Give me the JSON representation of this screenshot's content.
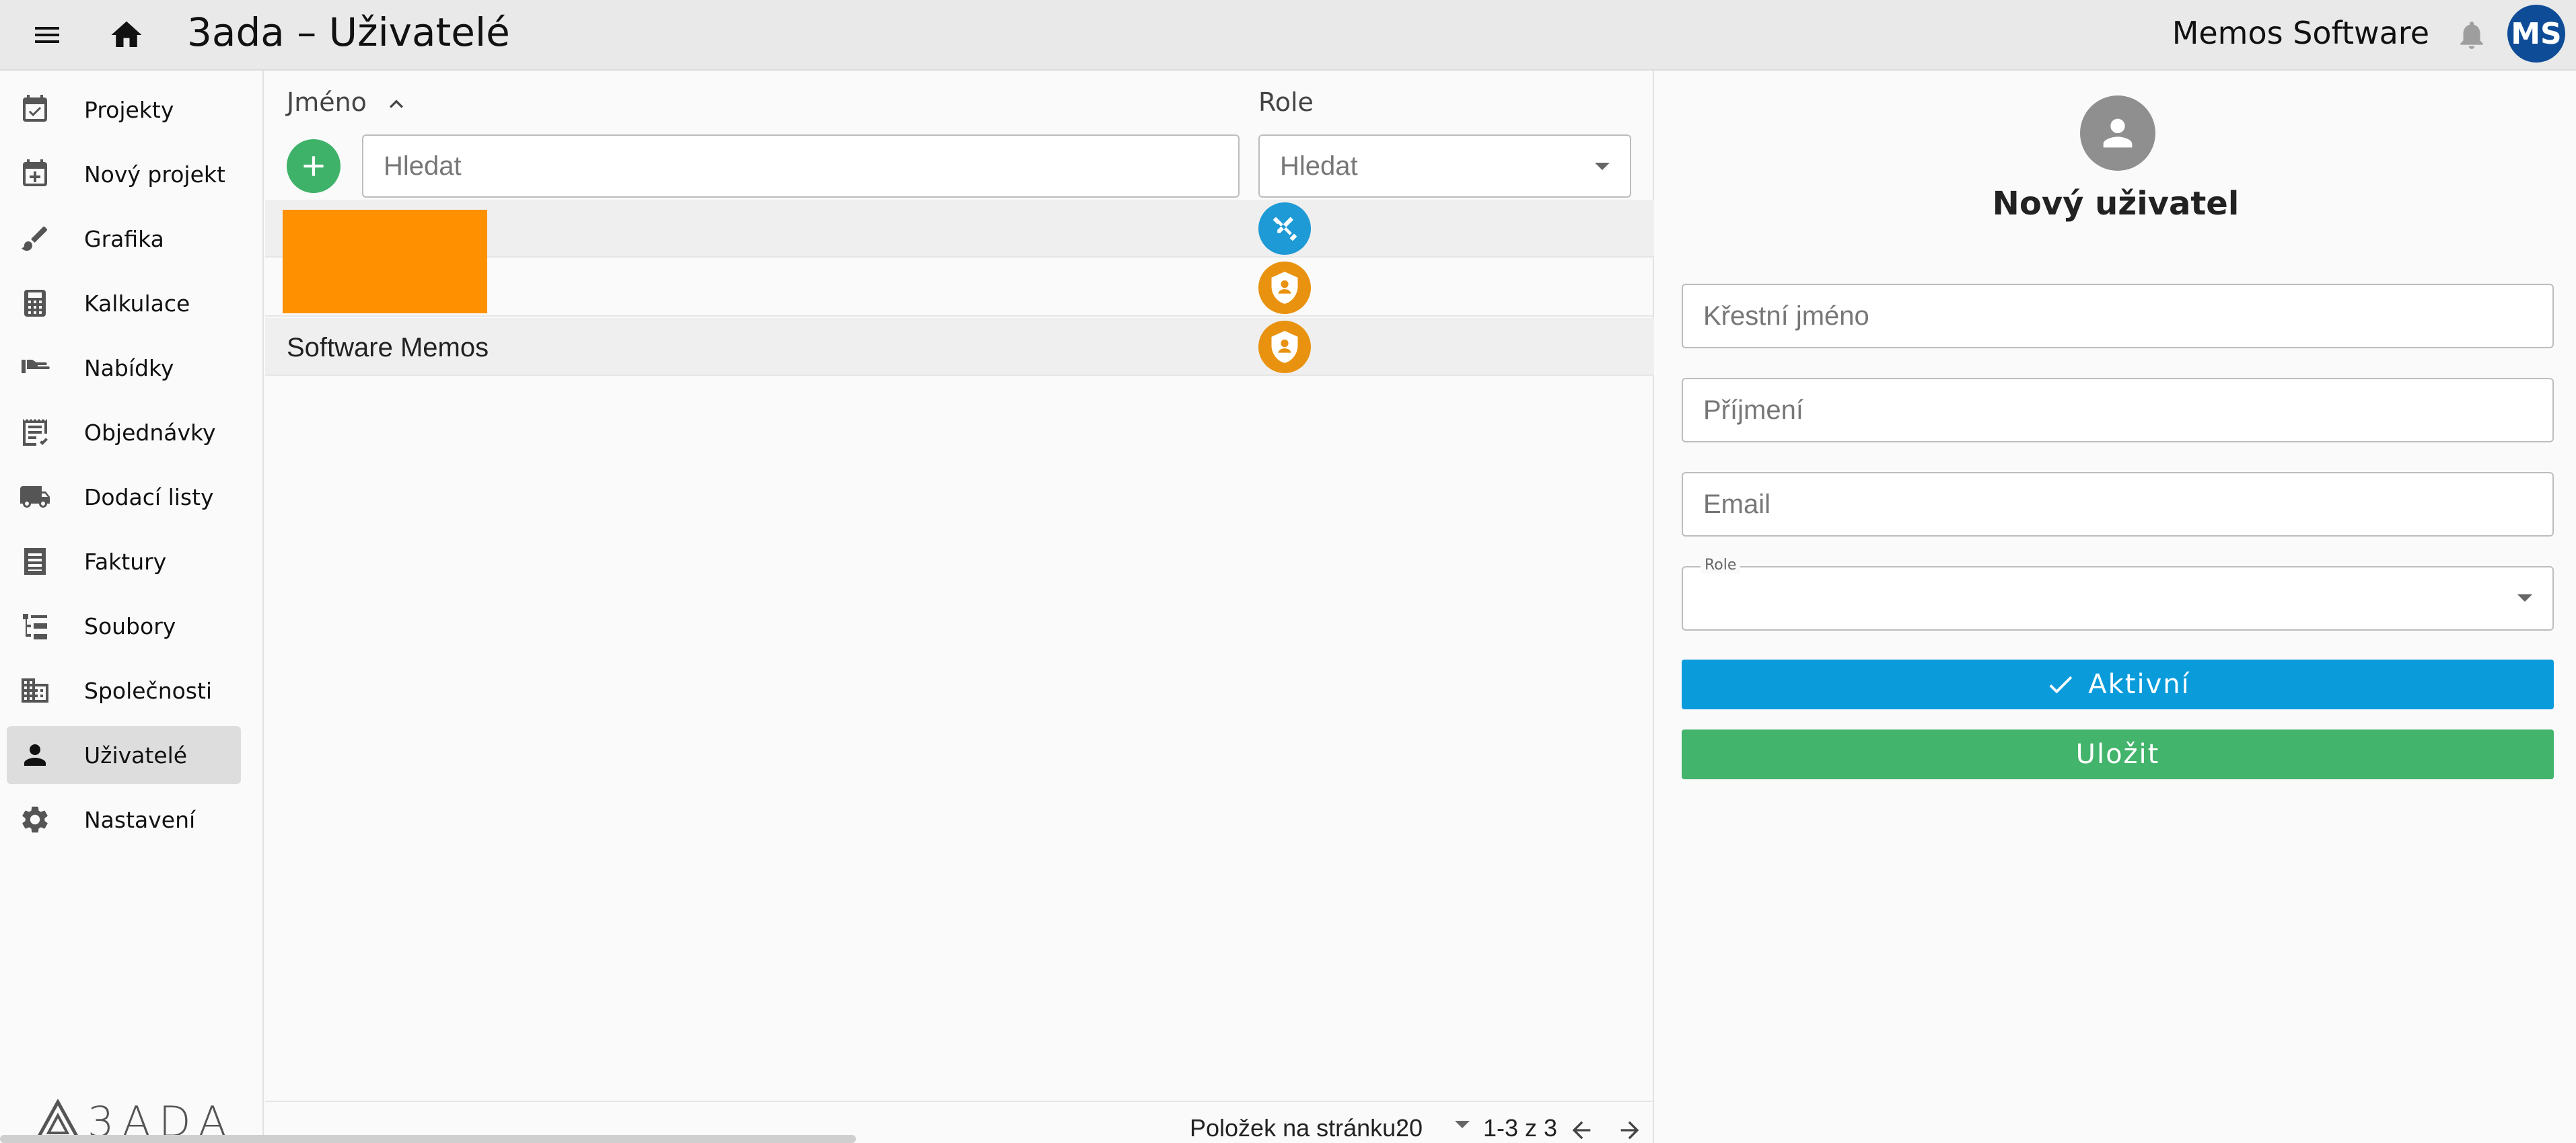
{
  "header": {
    "title": "3ada – Uživatelé",
    "company": "Memos Software",
    "avatar_initials": "MS",
    "icons": [
      "menu-icon",
      "home-icon",
      "bell-icon"
    ]
  },
  "sidebar": {
    "items": [
      {
        "label": "Projekty",
        "icon": "calendar-check-icon"
      },
      {
        "label": "Nový projekt",
        "icon": "calendar-plus-icon"
      },
      {
        "label": "Grafika",
        "icon": "brush-icon"
      },
      {
        "label": "Kalkulace",
        "icon": "calculator-icon"
      },
      {
        "label": "Nabídky",
        "icon": "hand-offer-icon"
      },
      {
        "label": "Objednávky",
        "icon": "receipt-icon"
      },
      {
        "label": "Dodací listy",
        "icon": "truck-icon"
      },
      {
        "label": "Faktury",
        "icon": "invoice-icon"
      },
      {
        "label": "Soubory",
        "icon": "file-tree-icon"
      },
      {
        "label": "Společnosti",
        "icon": "building-icon"
      },
      {
        "label": "Uživatelé",
        "icon": "person-icon"
      },
      {
        "label": "Nastavení",
        "icon": "gear-icon"
      }
    ],
    "active_index": 10,
    "logo_text": "3ADA"
  },
  "table": {
    "columns": {
      "name": "Jméno",
      "role": "Role"
    },
    "name_search_placeholder": "Hledat",
    "role_search_placeholder": "Hledat",
    "rows": [
      {
        "name": "",
        "role_icon": "engineer-tools-icon",
        "role_color": "#1e9ad6"
      },
      {
        "name": "",
        "role_icon": "admin-shield-icon",
        "role_color": "#e8920f"
      },
      {
        "name": "Software Memos",
        "role_icon": "admin-shield-icon",
        "role_color": "#e8920f"
      }
    ],
    "footer": {
      "per_page_label": "Položek na stránku:",
      "per_page_value": "20",
      "range": "1-3 z 3"
    }
  },
  "form": {
    "title": "Nový uživatel",
    "first_name_placeholder": "Křestní jméno",
    "last_name_placeholder": "Příjmení",
    "email_placeholder": "Email",
    "role_label": "Role",
    "role_value": "",
    "active_button": "Aktivní",
    "save_button": "Uložit"
  },
  "colors": {
    "accent_blue": "#0a9bdb",
    "save_green": "#42b46b",
    "add_green": "#3fb26a",
    "avatar_blue": "#0f4c97",
    "role_orange": "#e8920f",
    "redaction_orange": "#ff9100"
  }
}
